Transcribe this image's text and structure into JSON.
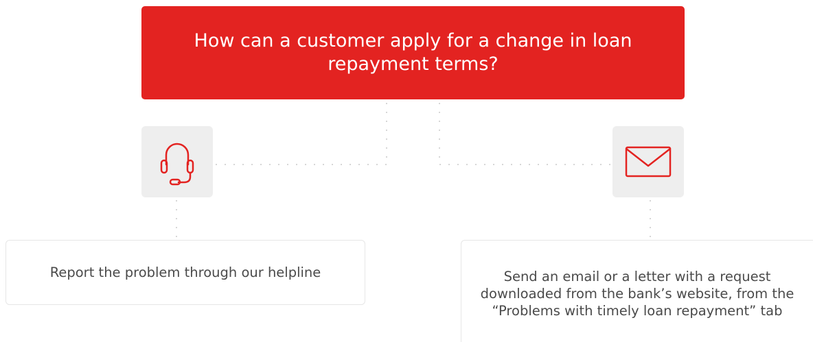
{
  "question": {
    "text": "How can a customer apply for a change in loan repayment terms?"
  },
  "options": [
    {
      "icon": "headset-icon",
      "text": "Report the problem through our helpline"
    },
    {
      "icon": "envelope-icon",
      "text": "Send an email or a letter with a request downloaded from the bank’s website, from the “Problems with timely loan repayment” tab"
    }
  ],
  "colors": {
    "accent": "#e32321",
    "tile": "#eeeeee",
    "text": "#4a4a4a",
    "connector": "#c8c8c8"
  }
}
